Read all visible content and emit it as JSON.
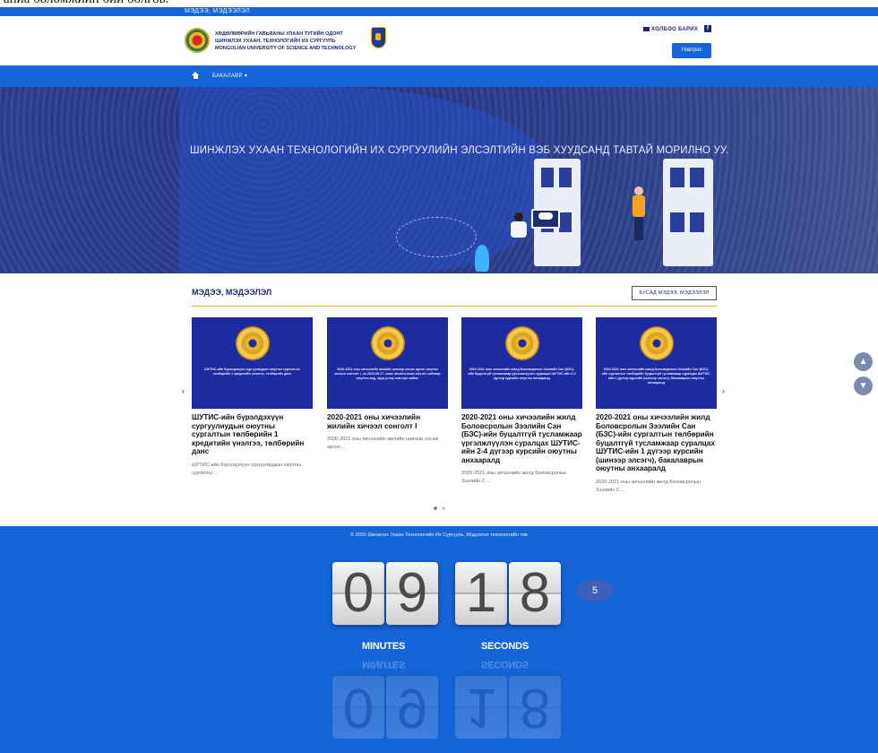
{
  "clipped_top_text": "аниа боломжийн бий болгов.",
  "topstrip": {
    "news_label": "МЭДЭЭ, МЭДЭЭЛЭЛ"
  },
  "header": {
    "logo_lines": [
      "ХӨДӨЛМӨРИЙН ГАВЬЯАНЫ УЛААН ТУГИЙН ОДОНТ",
      "ШИНЖЛЭХ УХААН, ТЕХНОЛОГИЙН ИХ СУРГУУЛЬ",
      "MONGOLIAN UNIVERSITY OF SCIENCE AND TECHNOLOGY"
    ],
    "contact_label": "ХОЛБОО БАРИХ",
    "facebook_label": "f",
    "login_label": "Нэвтрэх"
  },
  "nav": {
    "menu_label": "БАКАЛАВР ▾"
  },
  "hero": {
    "title": "ШИНЖЛЭХ УХААН ТЕХНОЛОГИЙН ИХ СУРГУУЛИЙН ЭЛСЭЛТИЙН ВЭБ ХУУДСАНД ТАВТАЙ МОРИЛНО УУ."
  },
  "news": {
    "heading": "МЭДЭЭ, МЭДЭЭЛЭЛ",
    "more_label": "БУСАД МЭДЭЭ, МЭДЭЭЛЭЛ",
    "prev_arrow": "‹",
    "next_arrow": "›",
    "cards": [
      {
        "thumb_text": "ШУТИС-ийн бүрэлдэхүүн сургуулиудын оюутны сургалтын төлбөрийн 1 кредитийн үнэлгээ, төлбөрийн данс",
        "title": "ШУТИС-ийн бүрэлдэхүүн сургуулиудын оюутны сургалтын төлбөрийн 1 кредитийн үнэлгээ, төлбөрийн данс",
        "snippet": "ШУТИС-ийн бүрэлдэхүүн сургуулиудын оюутны сургалты ..."
      },
      {
        "thumb_text": "2020-2021 оны хичээлийн жилийн шинээр элсэж орсон оюутан хичээл сонголт I -ээ 2020-09-17 -ноос student.must.edu.mn сайтаар оюутны код, нууц үгээр нэвтэрч хийнэ.",
        "title": "2020-2021 оны хичээлийн жилийн хичээл сонголт I",
        "snippet": "2020-2021 оны хичээлийн жилийн шинээр элсэж орсон ..."
      },
      {
        "thumb_text": "2020-2021 оны хичээлийн жилд Боловсролын Зээлийн Сан (БЗС)-ийн буцалтгүй тусламжаар үргэлжлүүлэн суралцах ШУТИС-ийн 2-4 дүгээр курсийн оюутны анхааралд",
        "title": "2020-2021 оны хичээлийн жилд Боловсролын Зээлийн Сан (БЗС)-ийн буцалтгүй тусламжаар үргэлжлүүлэн суралцах ШУТИС-ийн 2-4 дүгээр курсийн оюутны анхааралд",
        "snippet": "2020-2021 оны хичээлийн жилд Боловсролын Зээлийн С ..."
      },
      {
        "thumb_text": "2020-2021 оны хичээлийн жилд Боловсролын Зээлийн Сан (БЗС)-ийн сургалтын төлбөрийн буцалтгүй тусламжаар суралцах ШУТИС-ийн 1 дүгээр курсийн (шинээр элсэгч), бакалаврын оюутны анхааралд",
        "title": "2020-2021 оны хичээлийн жилд Боловсролын Зээлийн Сан (БЗС)-ийн сургалтын төлбөрийн буцалтгүй тусламжаар суралцах ШУТИС-ийн 1 дүгээр курсийн (шинээр элсэгч), бакалаврын оюутны анхааралд",
        "snippet": "2020-2021 оны хичээлийн жилд Боловсролын Зээлийн С ..."
      }
    ]
  },
  "scroll": {
    "up_icon": "▲",
    "down_icon": "▼"
  },
  "footer": {
    "copyright": "© 2020 Шинжлэх Ухаан Технологийн Их Сургууль. Мэдээлэл технологийн төв"
  },
  "timer": {
    "minutes_digits": [
      "0",
      "9"
    ],
    "seconds_digits": [
      "1",
      "8"
    ],
    "minutes_label": "MINUTES",
    "seconds_label": "SECONDS",
    "badge": "5"
  },
  "colors": {
    "primary_blue": "#1565d8",
    "gold_accent": "#f0b429",
    "navy_text": "#1b2a6b",
    "card_blue": "#1e2aa0"
  }
}
